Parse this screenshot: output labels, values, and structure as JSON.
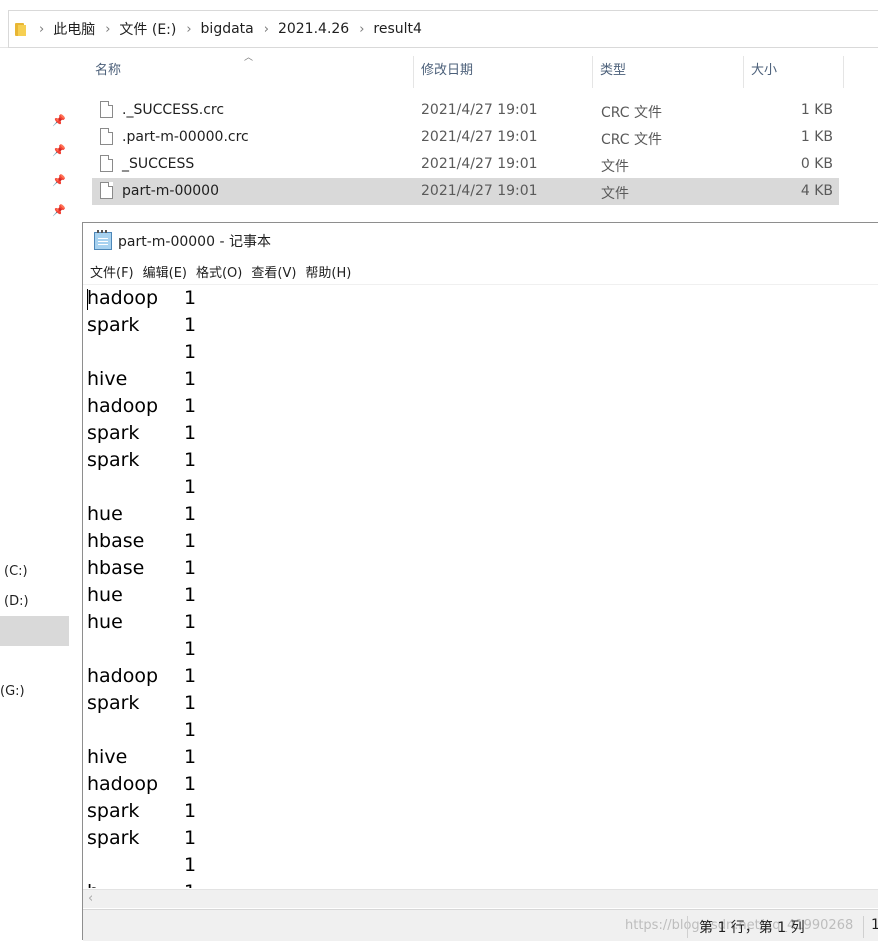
{
  "explorer": {
    "breadcrumb": [
      "此电脑",
      "文件 (E:)",
      "bigdata",
      "2021.4.26",
      "result4"
    ],
    "columns": [
      "名称",
      "修改日期",
      "类型",
      "大小"
    ],
    "files": [
      {
        "name": "._SUCCESS.crc",
        "date": "2021/4/27 19:01",
        "type": "CRC 文件",
        "size": "1 KB"
      },
      {
        "name": ".part-m-00000.crc",
        "date": "2021/4/27 19:01",
        "type": "CRC 文件",
        "size": "1 KB"
      },
      {
        "name": "_SUCCESS",
        "date": "2021/4/27 19:01",
        "type": "文件",
        "size": "0 KB"
      },
      {
        "name": "part-m-00000",
        "date": "2021/4/27 19:01",
        "type": "文件",
        "size": "4 KB"
      }
    ],
    "selected_file_index": 3,
    "nav_drives": [
      "(C:)",
      "(D:)",
      "(G:)"
    ]
  },
  "notepad": {
    "title": "part-m-00000 - 记事本",
    "menu": [
      "文件(F)",
      "编辑(E)",
      "格式(O)",
      "查看(V)",
      "帮助(H)"
    ],
    "lines": [
      {
        "word": "hadoop",
        "count": "1"
      },
      {
        "word": "spark",
        "count": "1"
      },
      {
        "word": "",
        "count": "1"
      },
      {
        "word": "hive",
        "count": "1"
      },
      {
        "word": "hadoop",
        "count": "1"
      },
      {
        "word": "spark",
        "count": "1"
      },
      {
        "word": "spark",
        "count": "1"
      },
      {
        "word": "",
        "count": "1"
      },
      {
        "word": "hue",
        "count": "1"
      },
      {
        "word": "hbase",
        "count": "1"
      },
      {
        "word": "hbase",
        "count": "1"
      },
      {
        "word": "hue",
        "count": "1"
      },
      {
        "word": "hue",
        "count": "1"
      },
      {
        "word": "",
        "count": "1"
      },
      {
        "word": "hadoop",
        "count": "1"
      },
      {
        "word": "spark",
        "count": "1"
      },
      {
        "word": "",
        "count": "1"
      },
      {
        "word": "hive",
        "count": "1"
      },
      {
        "word": "hadoop",
        "count": "1"
      },
      {
        "word": "spark",
        "count": "1"
      },
      {
        "word": "spark",
        "count": "1"
      },
      {
        "word": "",
        "count": "1"
      },
      {
        "word": "h",
        "count": "1"
      }
    ],
    "status_position": "第 1 行，第 1 列",
    "status_extra": "1",
    "watermark": "https://blog.csdn.net/qq_41990268"
  }
}
